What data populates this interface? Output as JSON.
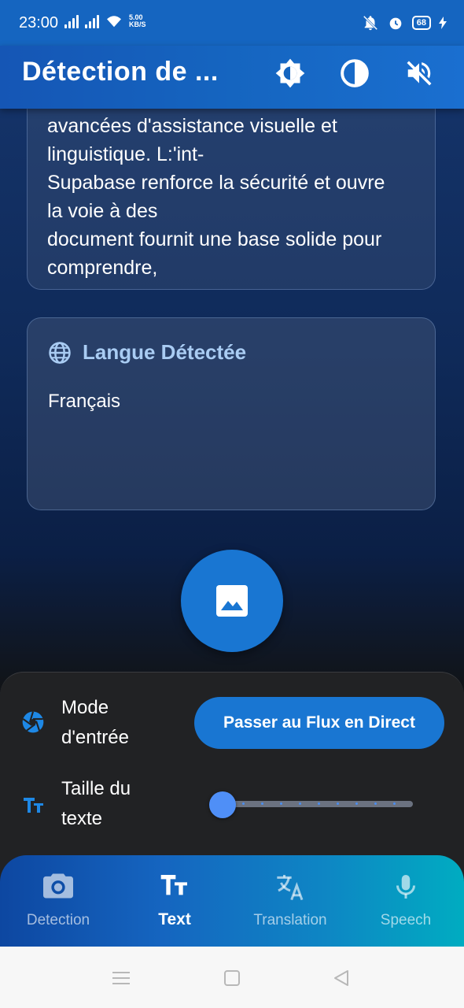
{
  "status_bar": {
    "time": "23:00",
    "net_speed": "5.00",
    "net_unit": "KB/S",
    "battery": "68"
  },
  "app_bar": {
    "title": "Détection de ...",
    "icons": [
      "brightness-icon",
      "contrast-icon",
      "volume-off-icon"
    ]
  },
  "text_card": {
    "lines": [
      "avancées d'assistance visuelle et",
      "linguistique. L:'int-",
      "Supabase renforce la sécurité et ouvre",
      "la voie à des",
      "document fournit une base solide pour",
      "comprendre,"
    ]
  },
  "language_card": {
    "title": "Langue Détectée",
    "value": "Français"
  },
  "controls": {
    "mode_label": "Mode\nd'entrée",
    "mode_line1": "Mode",
    "mode_line2": "d'entrée",
    "live_button": "Passer au Flux en Direct",
    "size_line1": "Taille du",
    "size_line2": "texte",
    "size_icon_text": "TT",
    "text_size_level": 0
  },
  "bottom_nav": {
    "items": [
      {
        "label": "Detection",
        "icon": "camera-icon",
        "active": false
      },
      {
        "label": "Text",
        "icon": "text-fields-icon",
        "active": true
      },
      {
        "label": "Translation",
        "icon": "translate-icon",
        "active": false
      },
      {
        "label": "Speech",
        "icon": "mic-icon",
        "active": false
      }
    ]
  },
  "colors": {
    "primary": "#1976d2",
    "accent_text": "#a9ccf3",
    "panel": "#212224"
  }
}
